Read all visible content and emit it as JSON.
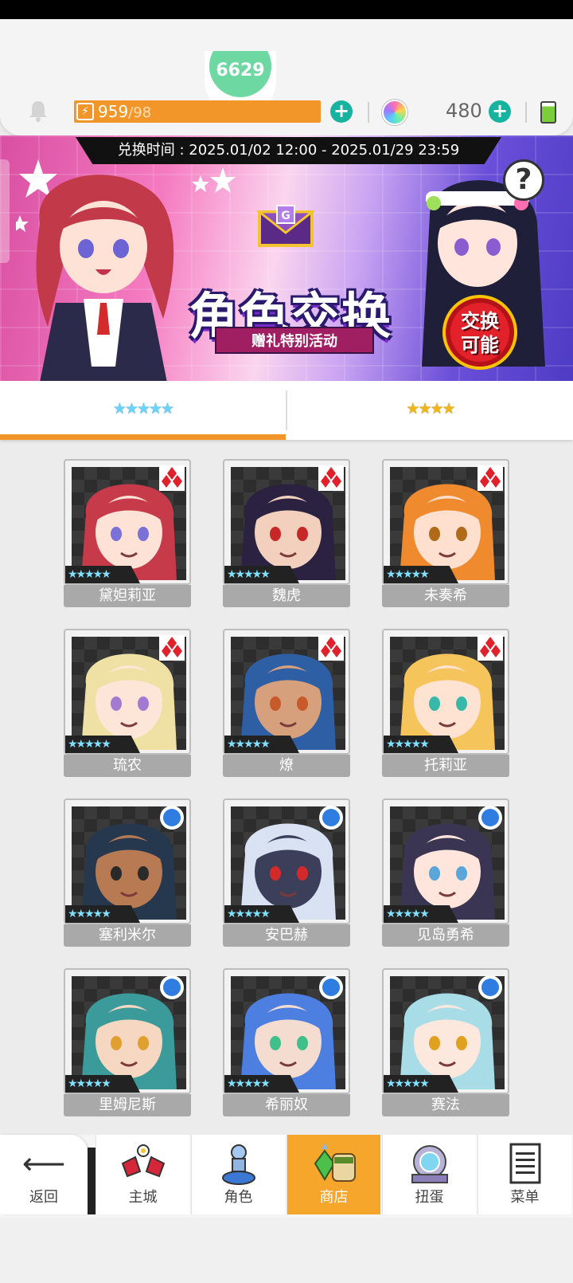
{
  "header": {
    "avatar_text": "6629",
    "stamina_current": "959",
    "stamina_max": "/98",
    "gem_count": "480"
  },
  "banner": {
    "period": "兑换时间 : 2025.01/02 12:00 - 2025.01/29 23:59",
    "title": "角色交换",
    "subtitle": "赠礼特别活动",
    "badge_line1": "交换",
    "badge_line2": "可能",
    "help_label": "?"
  },
  "tabs": [
    {
      "label": "★★★★★",
      "active": true
    },
    {
      "label": "★★★★",
      "active": false
    }
  ],
  "characters": [
    {
      "name": "黛妲莉亚",
      "stars": "★★★★★",
      "rank": "red-diamond",
      "hair": "#c73a49",
      "skin": "#ffe2d6",
      "eyes": "#7a70d8"
    },
    {
      "name": "魏虎",
      "stars": "★★★★★",
      "rank": "red-diamond",
      "hair": "#2a2240",
      "skin": "#f3d0bd",
      "eyes": "#c62828"
    },
    {
      "name": "未奏希",
      "stars": "★★★★★",
      "rank": "red-diamond",
      "hair": "#f08a2e",
      "skin": "#ffe0cf",
      "eyes": "#b06a18"
    },
    {
      "name": "琉农",
      "stars": "★★★★★",
      "rank": "red-diamond",
      "hair": "#efe0a4",
      "skin": "#fde6d8",
      "eyes": "#a37ad0"
    },
    {
      "name": "燎",
      "stars": "★★★★★",
      "rank": "red-diamond",
      "hair": "#2e5fa4",
      "skin": "#d7a07c",
      "eyes": "#c75a2a"
    },
    {
      "name": "托莉亚",
      "stars": "★★★★★",
      "rank": "red-diamond",
      "hair": "#f5c45a",
      "skin": "#ffe3d2",
      "eyes": "#38b8a8"
    },
    {
      "name": "塞利米尔",
      "stars": "★★★★★",
      "rank": "blue-circle",
      "hair": "#26384e",
      "skin": "#b77a52",
      "eyes": "#2a2a2a"
    },
    {
      "name": "安巴赫",
      "stars": "★★★★★",
      "rank": "blue-circle",
      "hair": "#d8e2f2",
      "skin": "#3b3f5a",
      "eyes": "#d22a2a"
    },
    {
      "name": "见岛勇希",
      "stars": "★★★★★",
      "rank": "blue-circle",
      "hair": "#3a3552",
      "skin": "#ffe5dc",
      "eyes": "#5aa6d8"
    },
    {
      "name": "里姆尼斯",
      "stars": "★★★★★",
      "rank": "blue-circle",
      "hair": "#3b9a9a",
      "skin": "#f6d8c2",
      "eyes": "#e0a030"
    },
    {
      "name": "希丽奴",
      "stars": "★★★★★",
      "rank": "blue-circle",
      "hair": "#4c7fe0",
      "skin": "#f4dcd0",
      "eyes": "#3fbf8a"
    },
    {
      "name": "赛法",
      "stars": "★★★★★",
      "rank": "blue-circle",
      "hair": "#a8dde8",
      "skin": "#fde8dd",
      "eyes": "#e0a020"
    }
  ],
  "nav": {
    "back": "返回",
    "items": [
      {
        "label": "主城",
        "icon": "castle-icon",
        "active": false
      },
      {
        "label": "角色",
        "icon": "character-icon",
        "active": false
      },
      {
        "label": "商店",
        "icon": "shop-icon",
        "active": true
      },
      {
        "label": "扭蛋",
        "icon": "gacha-icon",
        "active": false
      },
      {
        "label": "菜单",
        "icon": "menu-icon",
        "active": false
      }
    ]
  }
}
